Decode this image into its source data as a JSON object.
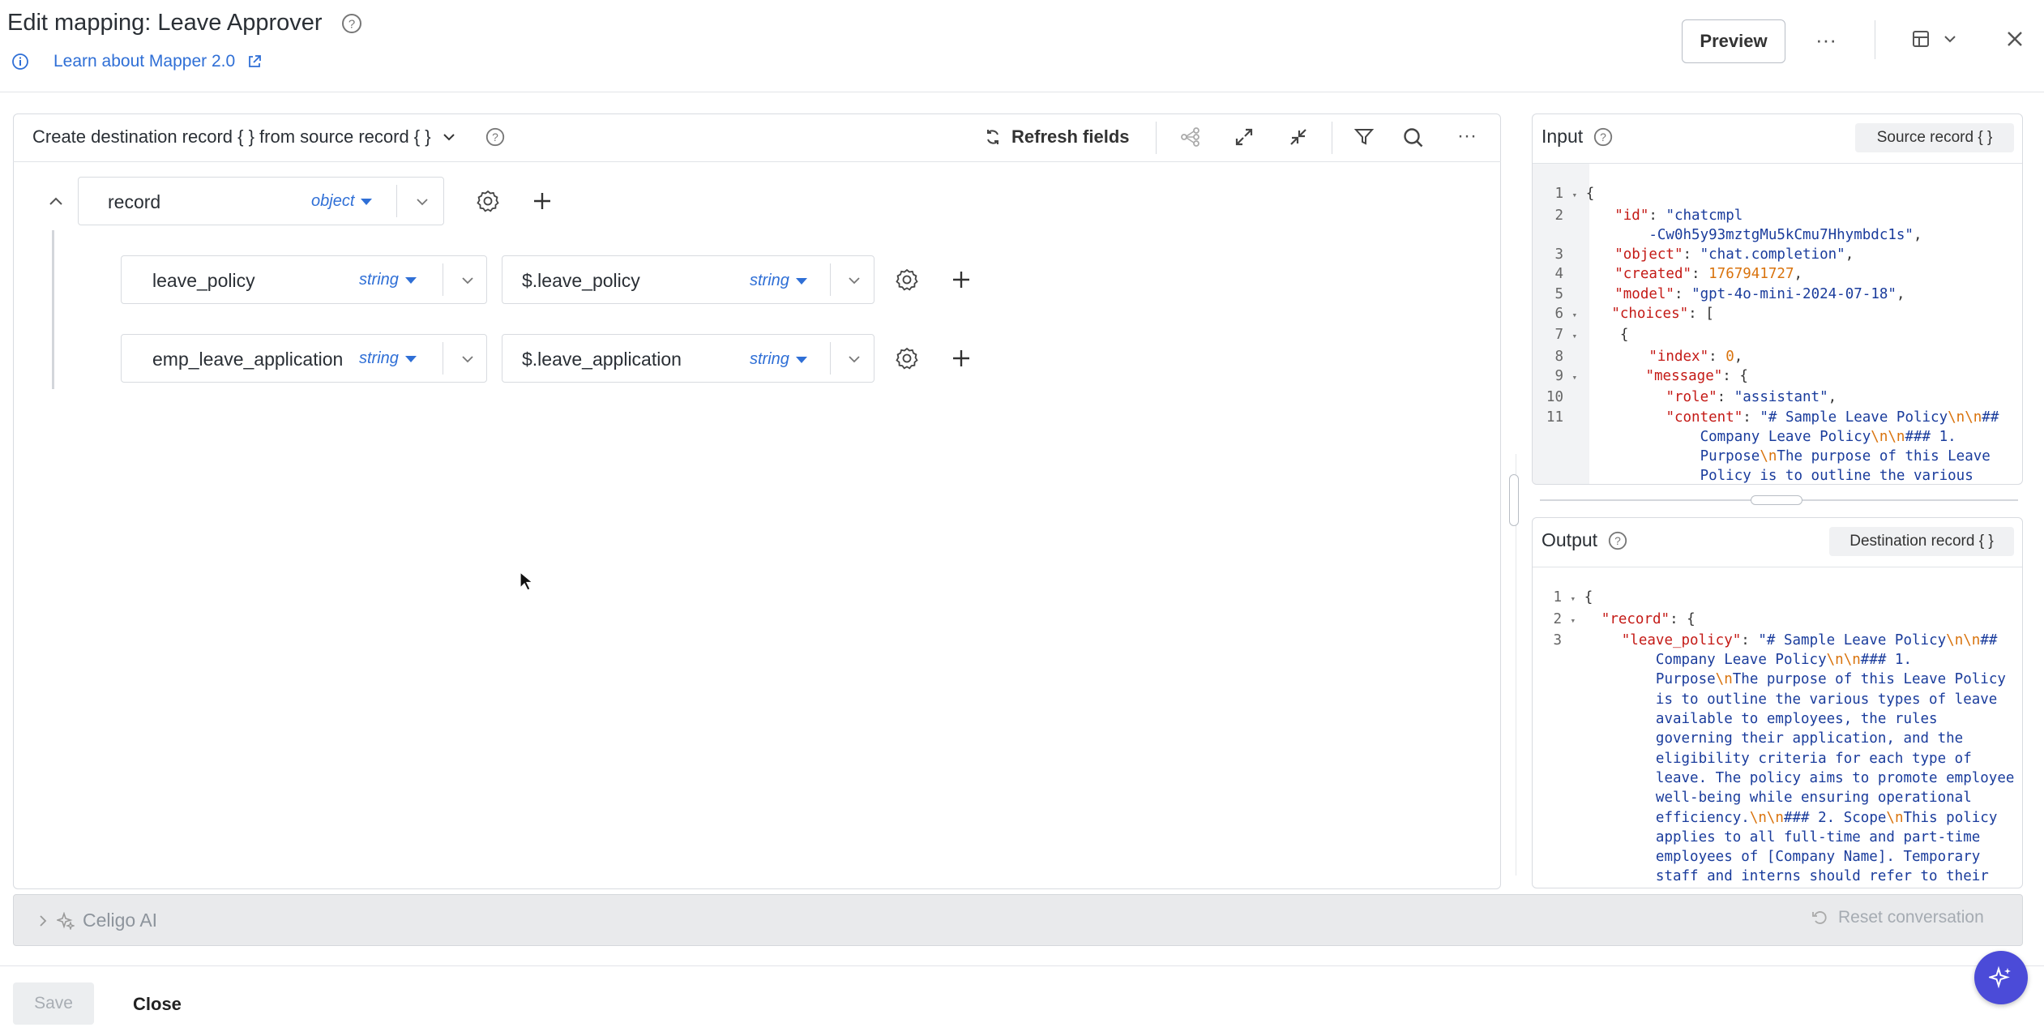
{
  "header": {
    "title": "Edit mapping: Leave Approver",
    "learn_link": "Learn about Mapper 2.0",
    "preview_label": "Preview",
    "more_label": "···"
  },
  "mapper": {
    "create_label": "Create destination record { } from source record { }",
    "refresh_label": "Refresh fields",
    "more_label": "···",
    "root": {
      "name": "record",
      "type": "object"
    },
    "rows": [
      {
        "dest": "leave_policy",
        "dest_type": "string",
        "source": "$.leave_policy",
        "source_type": "string"
      },
      {
        "dest": "emp_leave_application",
        "dest_type": "string",
        "source": "$.leave_application",
        "source_type": "string"
      }
    ]
  },
  "input_panel": {
    "title": "Input",
    "button": "Source record { }",
    "line_numbers": [
      "1",
      "2",
      "",
      "3",
      "4",
      "5",
      "6",
      "7",
      "8",
      "9",
      "10",
      "11",
      "",
      "",
      "",
      ""
    ]
  },
  "output_panel": {
    "title": "Output",
    "button": "Destination record { }",
    "line_numbers": [
      "1",
      "2",
      "3",
      "",
      "",
      "",
      "",
      "",
      "",
      "",
      "",
      "",
      "",
      "",
      "",
      ""
    ]
  },
  "ai_bar": {
    "label": "Celigo AI",
    "reset_label": "Reset conversation"
  },
  "footer": {
    "save_label": "Save",
    "close_label": "Close"
  },
  "colors": {
    "accent_blue": "#2f6fd6",
    "fab_purple": "#4b4bd8",
    "json_key": "#c41a16",
    "json_string": "#1a3c9c",
    "json_number": "#d9730d"
  }
}
